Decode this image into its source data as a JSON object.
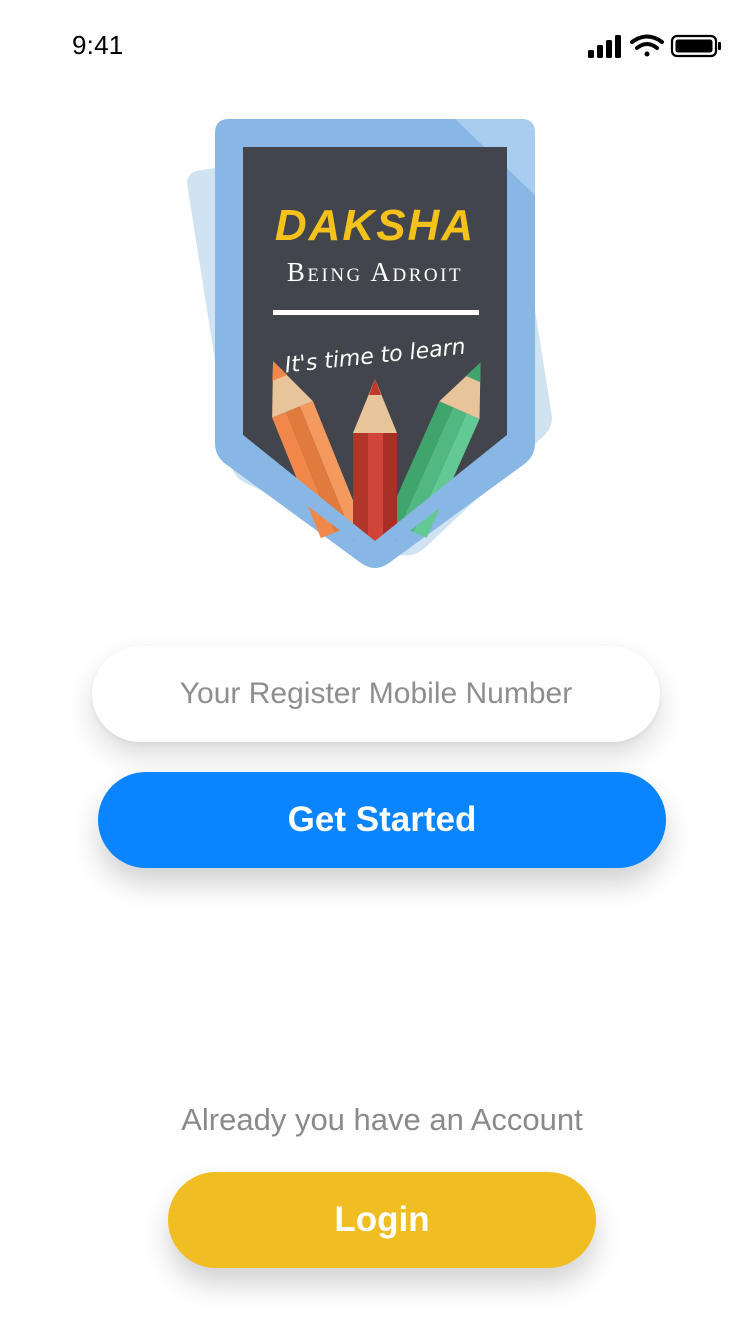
{
  "status_bar": {
    "time": "9:41",
    "icons": [
      "cellular-signal-icon",
      "wifi-icon",
      "battery-icon"
    ]
  },
  "logo": {
    "brand": "DAKSHA",
    "tagline": "Being Adroit",
    "slogan": "It's time to learn",
    "colors": {
      "shield_outer": "#89b7e5",
      "shield_back": "#cfe3f3",
      "board": "#42454b",
      "brand": "#f5c21b",
      "pencil_red": "#c0392b",
      "pencil_orange": "#f2874a",
      "pencil_green": "#52b882"
    }
  },
  "form": {
    "phone_placeholder": "Your Register Mobile Number",
    "phone_value": "",
    "get_started_label": "Get Started"
  },
  "footer": {
    "account_prompt": "Already you have an Account",
    "login_label": "Login"
  },
  "colors": {
    "primary": "#0a84ff",
    "accent": "#f0bd22",
    "muted_text": "#8a8a8a"
  }
}
